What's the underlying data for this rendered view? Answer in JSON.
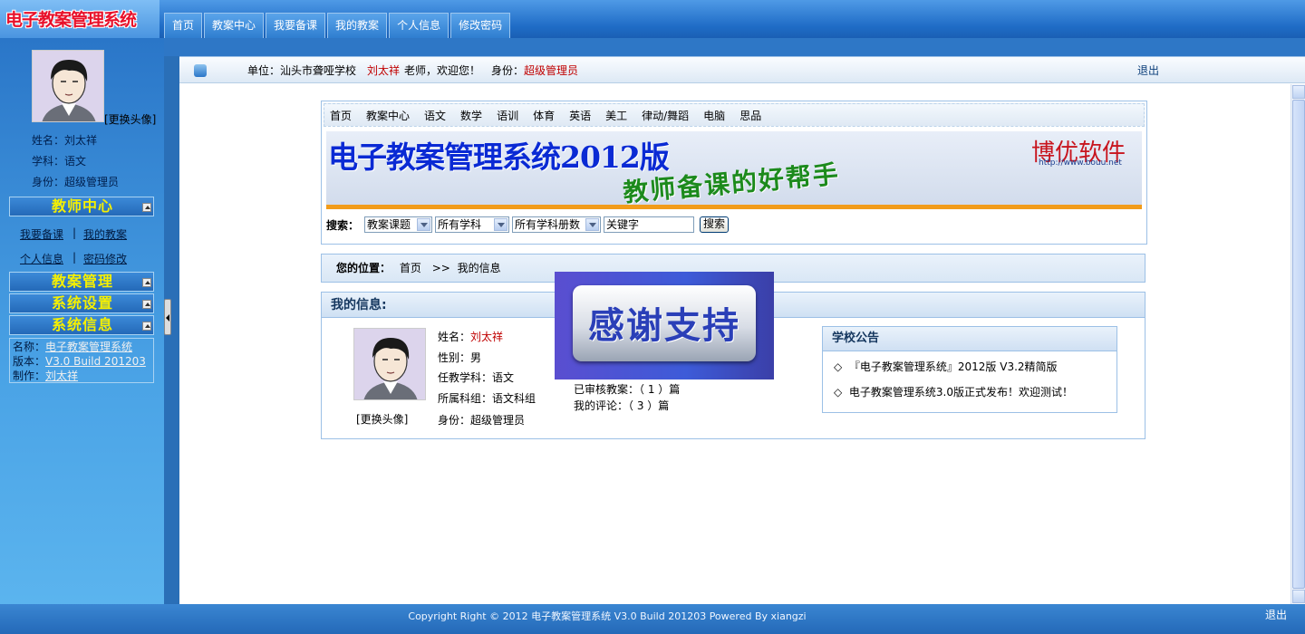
{
  "app": {
    "logo_text": "电子教案管理系统"
  },
  "topnav": [
    "首页",
    "教案中心",
    "我要备课",
    "我的教案",
    "个人信息",
    "修改密码"
  ],
  "sidebar": {
    "change_avatar": "[更换头像]",
    "name_line": "姓名：刘太祥",
    "subject_line": "学科：语文",
    "role_line": "身份：超级管理员",
    "sections": {
      "teacher_center": "教师中心",
      "lesson_mgmt": "教案管理",
      "system_settings": "系统设置",
      "system_info": "系统信息"
    },
    "links": {
      "prepare": "我要备课",
      "my_plans": "我的教案",
      "profile": "个人信息",
      "password": "密码修改",
      "separator": "|"
    },
    "sysinfo": {
      "name_label": "名称：",
      "name_value": "电子教案管理系统",
      "version_label": "版本：",
      "version_value": "V3.0 Build 201203",
      "author_label": "制作：",
      "author_value": "刘太祥"
    }
  },
  "infobar": {
    "unit_label": "单位：",
    "unit_value": "汕头市聋哑学校",
    "user_name": "刘太祥",
    "greeting": "老师，欢迎您！",
    "role_label": "身份：",
    "role_value": "超级管理员",
    "logout": "退出"
  },
  "inner_nav": [
    "首页",
    "教案中心",
    "语文",
    "数学",
    "语训",
    "体育",
    "英语",
    "美工",
    "律动/舞蹈",
    "电脑",
    "思品"
  ],
  "banner": {
    "title": "电子教案管理系统2012版",
    "subtitle": "教师备课的好帮手",
    "brand": "博优软件",
    "url": "http://www.bouu.net"
  },
  "search": {
    "label": "搜索：",
    "type_value": "教案课题",
    "subject_value": "所有学科",
    "volume_value": "所有学科册数",
    "keyword_value": "关键字",
    "button": "搜索"
  },
  "breadcrumb": {
    "label": "您的位置：",
    "home": "首页",
    "sep": ">>",
    "current": "我的信息"
  },
  "myinfo": {
    "title": "我的信息:",
    "change_avatar": "[更换头像]",
    "name_label": "姓名：",
    "name_value": "刘太祥",
    "gender": "性别：男",
    "subject": "任教学科：语文",
    "group": "所属科组：语文科组",
    "role": "身份：超级管理员",
    "reviewed": "已审核教案：（ 1 ）篇",
    "comments": "我的评论：（ 3 ）篇"
  },
  "notice": {
    "title": "学校公告",
    "bullet": "◇",
    "items": [
      "『电子教案管理系统』2012版 V3.2精简版",
      "电子教案管理系统3.0版正式发布！欢迎测试！"
    ]
  },
  "popup": {
    "text": "感谢支持"
  },
  "footer": {
    "text": "Copyright Right © 2012  电子教案管理系统 V3.0 Build 201203  Powered By xiangzi",
    "logout": "退出"
  }
}
